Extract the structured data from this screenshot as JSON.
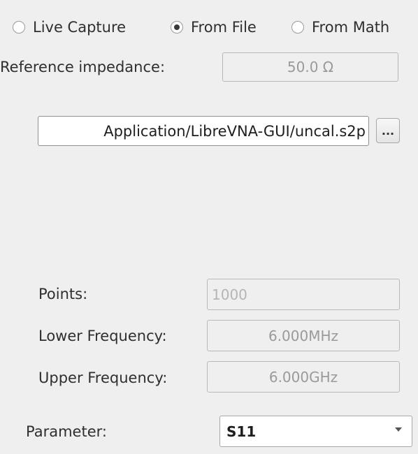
{
  "source": {
    "options": [
      {
        "label": "Live Capture",
        "selected": false
      },
      {
        "label": "From File",
        "selected": true
      },
      {
        "label": "From Math",
        "selected": false
      }
    ]
  },
  "reference_impedance": {
    "label": "Reference impedance:",
    "value": "50.0 Ω"
  },
  "file": {
    "path": "Application/LibreVNA-GUI/uncal.s2p",
    "browse_label": "..."
  },
  "info": {
    "points_label": "Points:",
    "points_value": "1000",
    "lower_label": "Lower Frequency:",
    "lower_value": "6.000MHz",
    "upper_label": "Upper Frequency:",
    "upper_value": "6.000GHz"
  },
  "parameter": {
    "label": "Parameter:",
    "value": "S11"
  }
}
